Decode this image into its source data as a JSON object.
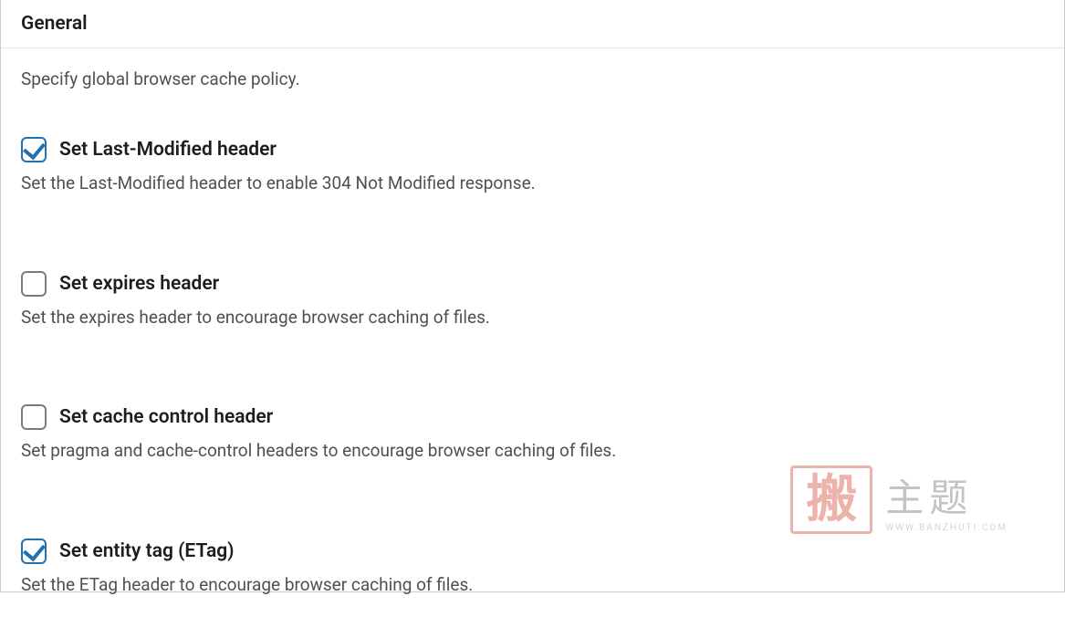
{
  "panel": {
    "title": "General",
    "description": "Specify global browser cache policy.",
    "options": [
      {
        "label": "Set Last-Modified header",
        "description": "Set the Last-Modified header to enable 304 Not Modified response.",
        "checked": true
      },
      {
        "label": "Set expires header",
        "description": "Set the expires header to encourage browser caching of files.",
        "checked": false
      },
      {
        "label": "Set cache control header",
        "description": "Set pragma and cache-control headers to encourage browser caching of files.",
        "checked": false
      },
      {
        "label": "Set entity tag (ETag)",
        "description": "Set the ETag header to encourage browser caching of files.",
        "checked": true
      }
    ]
  },
  "watermark": {
    "stamp": "搬",
    "cn": "主题",
    "url": "WWW.BANZHUTI.COM"
  }
}
